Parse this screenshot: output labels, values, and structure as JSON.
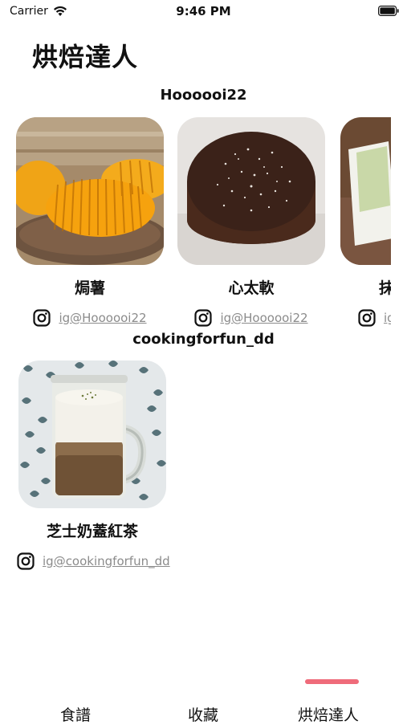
{
  "status_bar": {
    "carrier": "Carrier",
    "time": "9:46 PM"
  },
  "page_title": "烘焙達人",
  "sections": [
    {
      "heading": "Hoooooi22",
      "items": [
        {
          "title": "焗薯",
          "ig": "ig@Hoooooi22"
        },
        {
          "title": "心太軟",
          "ig": "ig@Hoooooi22"
        },
        {
          "title": "抹",
          "ig": "ig"
        }
      ]
    },
    {
      "heading": "cookingforfun_dd",
      "items": [
        {
          "title": "芝士奶蓋紅茶",
          "ig": "ig@cookingforfun_dd"
        }
      ]
    }
  ],
  "tabs": [
    {
      "label": "食譜"
    },
    {
      "label": "收藏"
    },
    {
      "label": "烘焙達人",
      "selected": true
    }
  ],
  "colors": {
    "tab_indicator": "#ef6b7a",
    "link": "#8b8b8b"
  }
}
